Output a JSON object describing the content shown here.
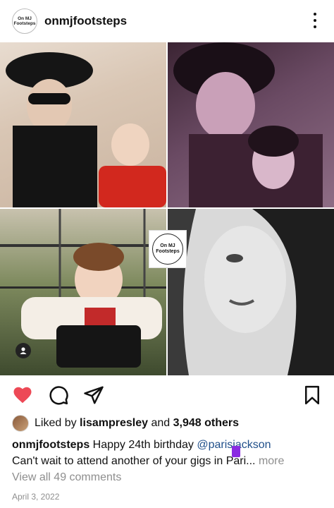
{
  "header": {
    "avatar_text": "On MJ Footsteps",
    "username": "onmjfootsteps",
    "more_icon": "more-vertical-icon"
  },
  "post": {
    "watermark_text": "On MJ Footsteps",
    "tag_icon": "person-tag-icon"
  },
  "actions": {
    "like_icon": "heart-filled-icon",
    "like_color": "#ed4956",
    "comment_icon": "comment-icon",
    "share_icon": "send-icon",
    "save_icon": "bookmark-icon"
  },
  "likes": {
    "prefix": "Liked by",
    "user": "lisampresley",
    "and": "and",
    "others": "3,948 others"
  },
  "caption": {
    "username": "onmjfootsteps",
    "text_start": "Happy 24th birthday",
    "mention": "@parisjackson",
    "line2_start": "Can't wait to attend another of your gigs",
    "line2_end": "in Pari",
    "ellipsis": "...",
    "more": "more"
  },
  "comments_link": "View all 49 comments",
  "date": "April 3, 2022",
  "colors": {
    "mention": "#1f4f8a",
    "muted": "#8e8e8e"
  }
}
